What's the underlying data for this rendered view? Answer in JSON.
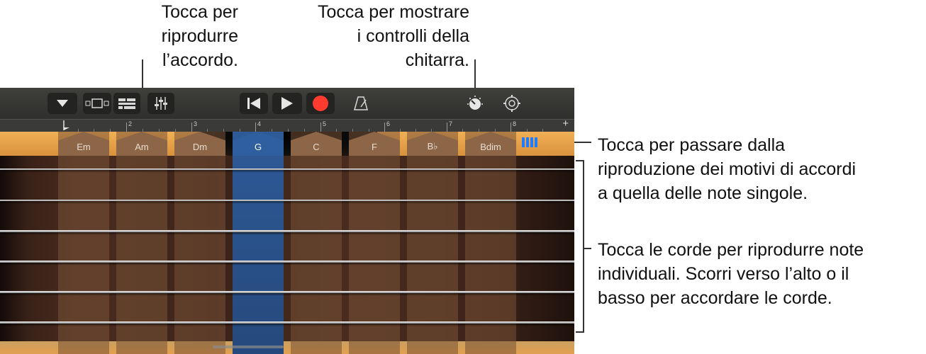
{
  "callouts": {
    "play_chord": "Tocca per\nriprodurre\nl’accordo.",
    "guitar_controls": "Tocca per mostrare\ni controlli della\nchitarra.",
    "switch_mode": "Tocca per passare dalla\nriproduzione dei motivi di accordi\na quella delle note singole.",
    "strings": "Tocca le corde per riprodurre note\nindividuali. Scorri verso l’alto o il\nbasso per accordare le corde."
  },
  "toolbar": {
    "icons": [
      "chevron-down",
      "view",
      "tracks",
      "mixer",
      "rewind",
      "play",
      "record",
      "metronome",
      "guitar-controls",
      "settings"
    ],
    "record_color": "#ff3b30"
  },
  "ruler": {
    "numbers": [
      "2",
      "3",
      "4",
      "5",
      "6",
      "7",
      "8"
    ],
    "add_label": "+"
  },
  "chords": [
    "Em",
    "Am",
    "Dm",
    "G",
    "C",
    "F",
    "B♭",
    "Bdim"
  ],
  "selected_chord": "G",
  "mode_indicator_color": "#1f7bff"
}
